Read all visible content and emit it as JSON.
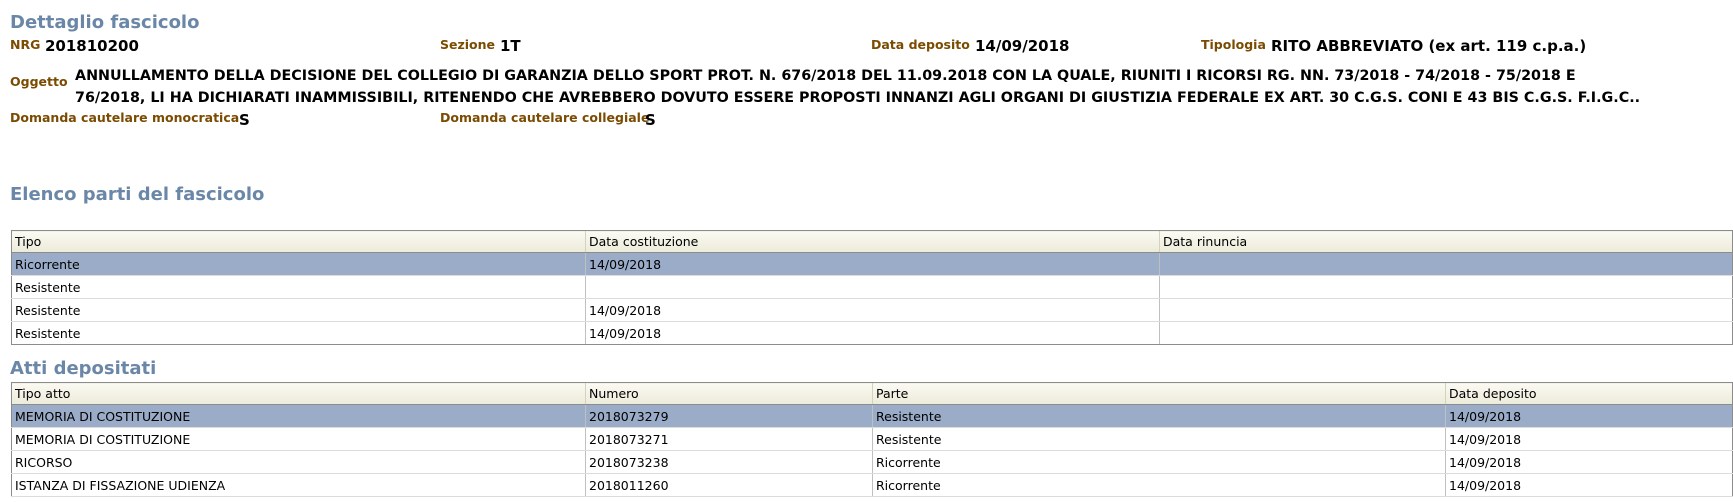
{
  "dettaglio": {
    "title": "Dettaglio fascicolo",
    "nrg_label": "NRG",
    "nrg_value": "201810200",
    "sezione_label": "Sezione",
    "sezione_value": "1T",
    "data_deposito_label": "Data deposito",
    "data_deposito_value": "14/09/2018",
    "tipologia_label": "Tipologia",
    "tipologia_value": "RITO ABBREVIATO (ex art. 119 c.p.a.)",
    "oggetto_label": "Oggetto",
    "oggetto_line1": "ANNULLAMENTO DELLA DECISIONE DEL COLLEGIO DI GARANZIA DELLO SPORT PROT. N. 676/2018 DEL 11.09.2018 CON LA QUALE, RIUNITI I RICORSI RG. NN. 73/2018 - 74/2018 - 75/2018 E",
    "oggetto_line2": "76/2018, LI HA DICHIARATI INAMMISSIBILI, RITENENDO CHE AVREBBERO DOVUTO ESSERE PROPOSTI INNANZI AGLI ORGANI DI GIUSTIZIA FEDERALE EX ART. 30 C.G.S. CONI E 43 BIS C.G.S. F.I.G.C..",
    "monocratica_label": "Domanda cautelare monocratica",
    "monocratica_value": "S",
    "collegiale_label": "Domanda cautelare collegiale",
    "collegiale_value": "S"
  },
  "parti": {
    "title": "Elenco parti del fascicolo",
    "headers": [
      "Tipo",
      "Data costituzione",
      "Data rinuncia"
    ],
    "rows": [
      [
        "Ricorrente",
        "14/09/2018",
        ""
      ],
      [
        "Resistente",
        "",
        ""
      ],
      [
        "Resistente",
        "14/09/2018",
        ""
      ],
      [
        "Resistente",
        "14/09/2018",
        ""
      ]
    ]
  },
  "atti": {
    "title": "Atti depositati",
    "headers": [
      "Tipo atto",
      "Numero",
      "Parte",
      "Data deposito"
    ],
    "rows": [
      [
        "MEMORIA DI COSTITUZIONE",
        "2018073279",
        "Resistente",
        "14/09/2018"
      ],
      [
        "MEMORIA DI COSTITUZIONE",
        "2018073271",
        "Resistente",
        "14/09/2018"
      ],
      [
        "RICORSO",
        "2018073238",
        "Ricorrente",
        "14/09/2018"
      ],
      [
        "ISTANZA DI FISSAZIONE UDIENZA",
        "2018011260",
        "Ricorrente",
        "14/09/2018"
      ]
    ]
  }
}
